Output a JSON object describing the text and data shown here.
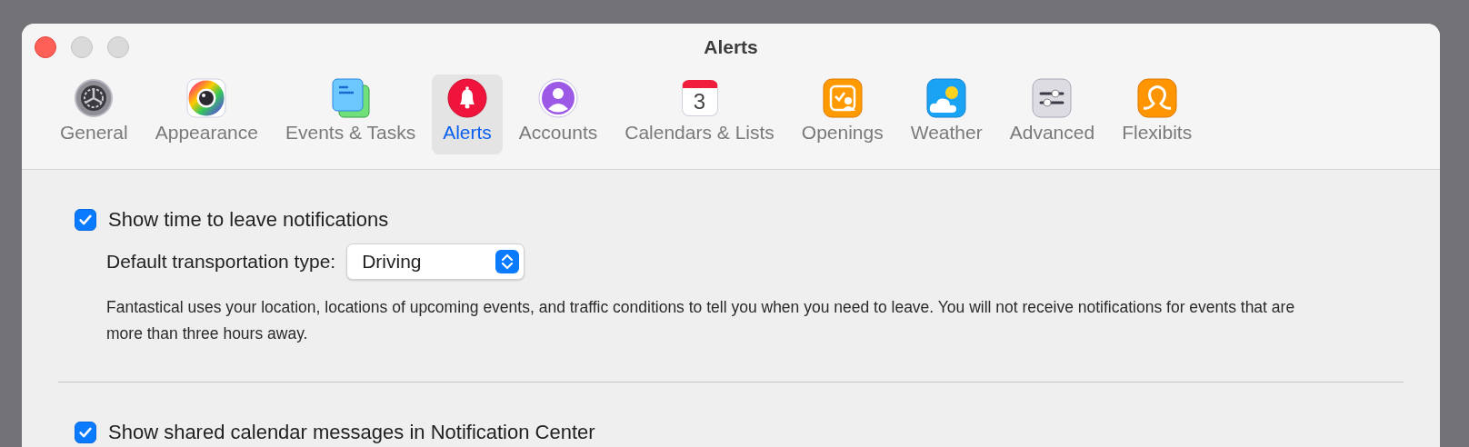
{
  "window": {
    "title": "Alerts"
  },
  "tabs": [
    {
      "label": "General",
      "kind": "gear",
      "selected": false
    },
    {
      "label": "Appearance",
      "kind": "palette",
      "selected": false
    },
    {
      "label": "Events & Tasks",
      "kind": "notes",
      "selected": false
    },
    {
      "label": "Alerts",
      "kind": "bell",
      "selected": true
    },
    {
      "label": "Accounts",
      "kind": "person",
      "selected": false
    },
    {
      "label": "Calendars & Lists",
      "kind": "calendar",
      "badge": "3",
      "selected": false
    },
    {
      "label": "Openings",
      "kind": "openings",
      "selected": false
    },
    {
      "label": "Weather",
      "kind": "weather",
      "selected": false
    },
    {
      "label": "Advanced",
      "kind": "sliders",
      "selected": false
    },
    {
      "label": "Flexibits",
      "kind": "loop",
      "selected": false
    }
  ],
  "sections": [
    {
      "checkbox": {
        "label": "Show time to leave notifications",
        "checked": true
      },
      "dropdown": {
        "label": "Default transportation type:",
        "value": "Driving"
      },
      "description": "Fantastical uses your location, locations of upcoming events, and traffic conditions to tell you when you need to leave. You will not receive notifications for events that are more than three hours away."
    },
    {
      "checkbox": {
        "label": "Show shared calendar messages in Notification Center",
        "checked": true
      }
    }
  ]
}
